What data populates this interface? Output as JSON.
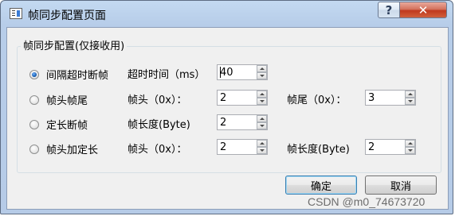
{
  "window": {
    "title": "帧同步配置页面",
    "help_glyph": "?",
    "close_glyph": "✕"
  },
  "group": {
    "title": "帧同步配置(仅接收用)"
  },
  "options": [
    {
      "label": "间隔超时断帧",
      "checked": true
    },
    {
      "label": "帧头帧尾",
      "checked": false
    },
    {
      "label": "定长断帧",
      "checked": false
    },
    {
      "label": "帧头加定长",
      "checked": false
    }
  ],
  "rows": {
    "timeout": {
      "label": "超时时间（ms）",
      "value": "40"
    },
    "headtail_head": {
      "label": "帧头（0x）：",
      "value": "2"
    },
    "headtail_tail": {
      "label": "帧尾（0x）：",
      "value": "3"
    },
    "fixed_len": {
      "label": "帧长度(Byte)",
      "value": "2"
    },
    "headlen_head": {
      "label": "帧头（0x）：",
      "value": "2"
    },
    "headlen_len": {
      "label": "帧长度(Byte)",
      "value": "2"
    }
  },
  "buttons": {
    "ok": "确定",
    "cancel": "取消"
  },
  "watermark": "CSDN @m0_74673720"
}
